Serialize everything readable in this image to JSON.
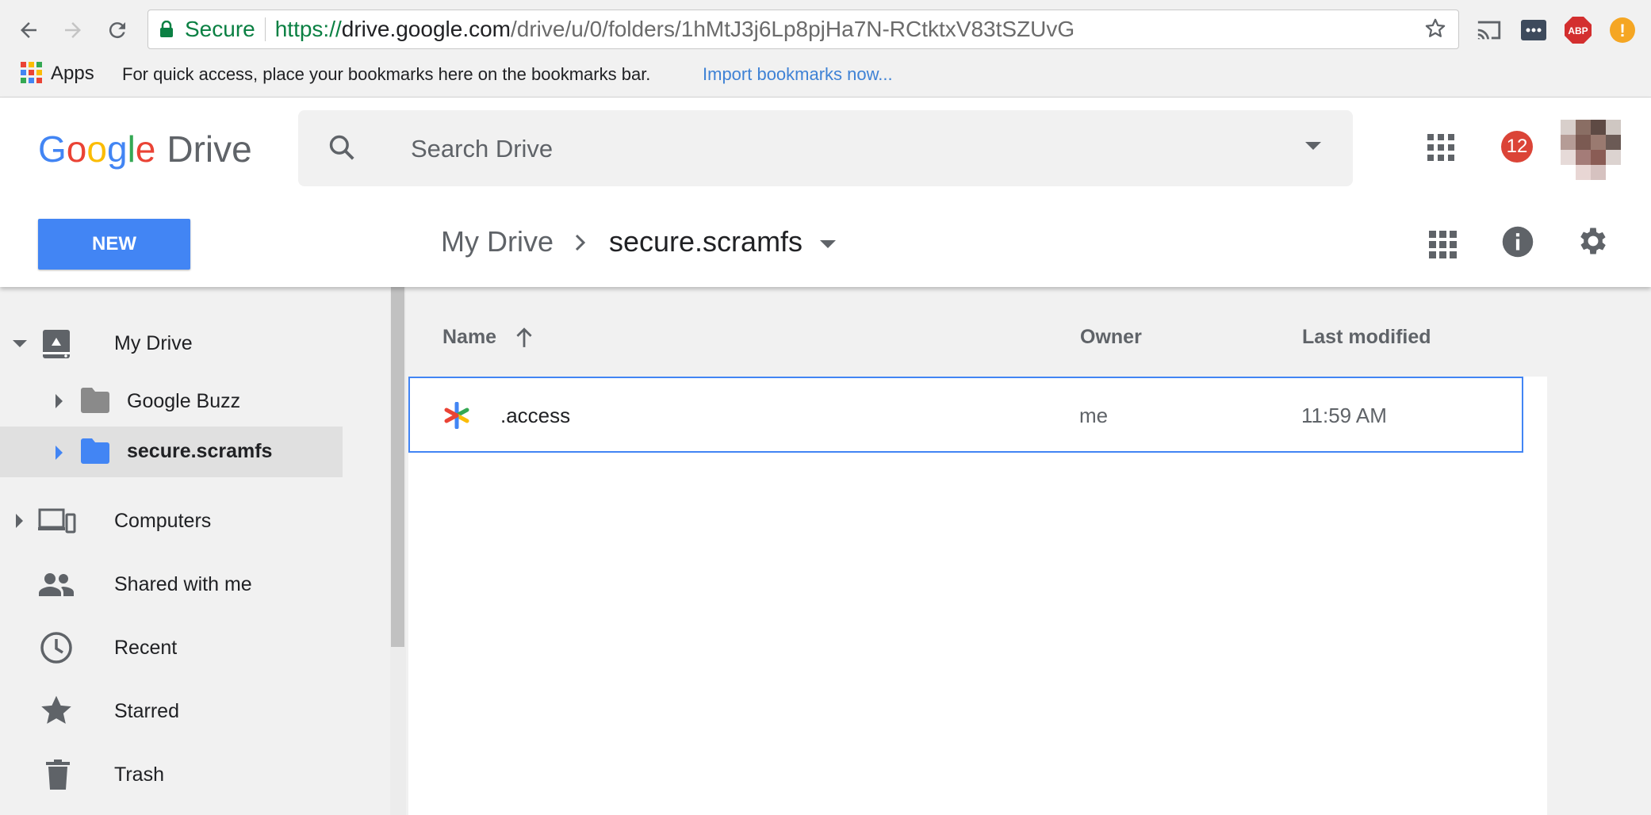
{
  "browser": {
    "secure_label": "Secure",
    "url_scheme": "https://",
    "url_host": "drive.google.com",
    "url_path": "/drive/u/0/folders/1hMtJ3j6Lp8pjHa7N-RCtktxV83tSZUvG",
    "extensions": [
      "cast-icon",
      "menu-extension-icon",
      "abp-icon",
      "alert-icon"
    ],
    "abp_label": "ABP",
    "alert_label": "!"
  },
  "bookmarks": {
    "apps_label": "Apps",
    "hint": "For quick access, place your bookmarks here on the bookmarks bar.",
    "import_link": "Import bookmarks now..."
  },
  "header": {
    "logo_letters": [
      "G",
      "o",
      "o",
      "g",
      "l",
      "e"
    ],
    "logo_colors": [
      "#4285f4",
      "#ea4335",
      "#fbbc05",
      "#4285f4",
      "#34a853",
      "#ea4335"
    ],
    "product": "Drive",
    "search_placeholder": "Search Drive",
    "notification_count": "12"
  },
  "toolbar": {
    "new_label": "NEW",
    "breadcrumb_root": "My Drive",
    "breadcrumb_current": "secure.scramfs"
  },
  "sidebar": {
    "my_drive": "My Drive",
    "google_buzz": "Google Buzz",
    "secure_scramfs": "secure.scramfs",
    "computers": "Computers",
    "shared": "Shared with me",
    "recent": "Recent",
    "starred": "Starred",
    "trash": "Trash"
  },
  "list": {
    "col_name": "Name",
    "col_owner": "Owner",
    "col_modified": "Last modified",
    "rows": [
      {
        "name": ".access",
        "owner": "me",
        "modified": "11:59 AM"
      }
    ]
  },
  "colors": {
    "accent": "#4285f4",
    "folder_gray": "#8a8a8a",
    "folder_blue": "#4285f4",
    "notification": "#db4437"
  }
}
